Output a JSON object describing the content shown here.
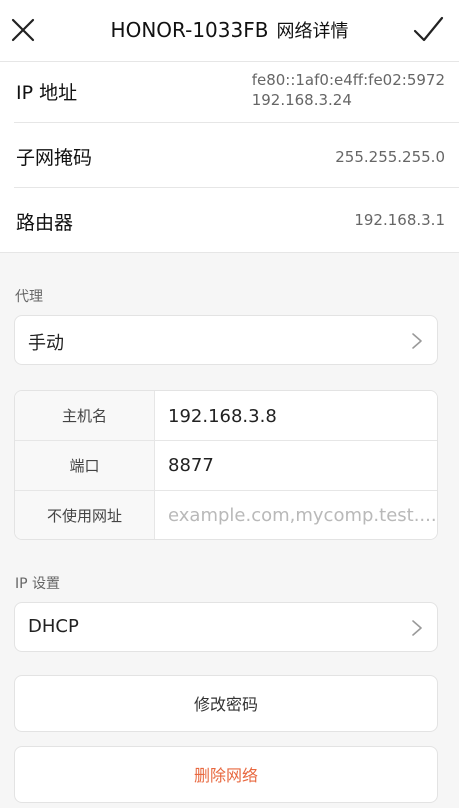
{
  "header": {
    "ssid": "HONOR-1033FB",
    "subtitle": "网络详情"
  },
  "info": {
    "ip_label": "IP 地址",
    "ip_v6": "fe80::1af0:e4ff:fe02:5972",
    "ip_v4": "192.168.3.24",
    "mask_label": "子网掩码",
    "mask_value": "255.255.255.0",
    "router_label": "路由器",
    "router_value": "192.168.3.1"
  },
  "proxy": {
    "section_title": "代理",
    "mode": "手动",
    "host_label": "主机名",
    "host_value": "192.168.3.8",
    "port_label": "端口",
    "port_value": "8877",
    "bypass_label": "不使用网址",
    "bypass_placeholder": "example.com,mycomp.test...."
  },
  "ip_settings": {
    "section_title": "IP 设置",
    "mode": "DHCP"
  },
  "actions": {
    "change_password": "修改密码",
    "delete_network": "删除网络"
  },
  "colors": {
    "danger": "#e8683f",
    "background": "#f6f6f6"
  },
  "icons": {
    "close": "close-icon",
    "confirm": "check-icon",
    "chevron": "chevron-right-icon"
  }
}
